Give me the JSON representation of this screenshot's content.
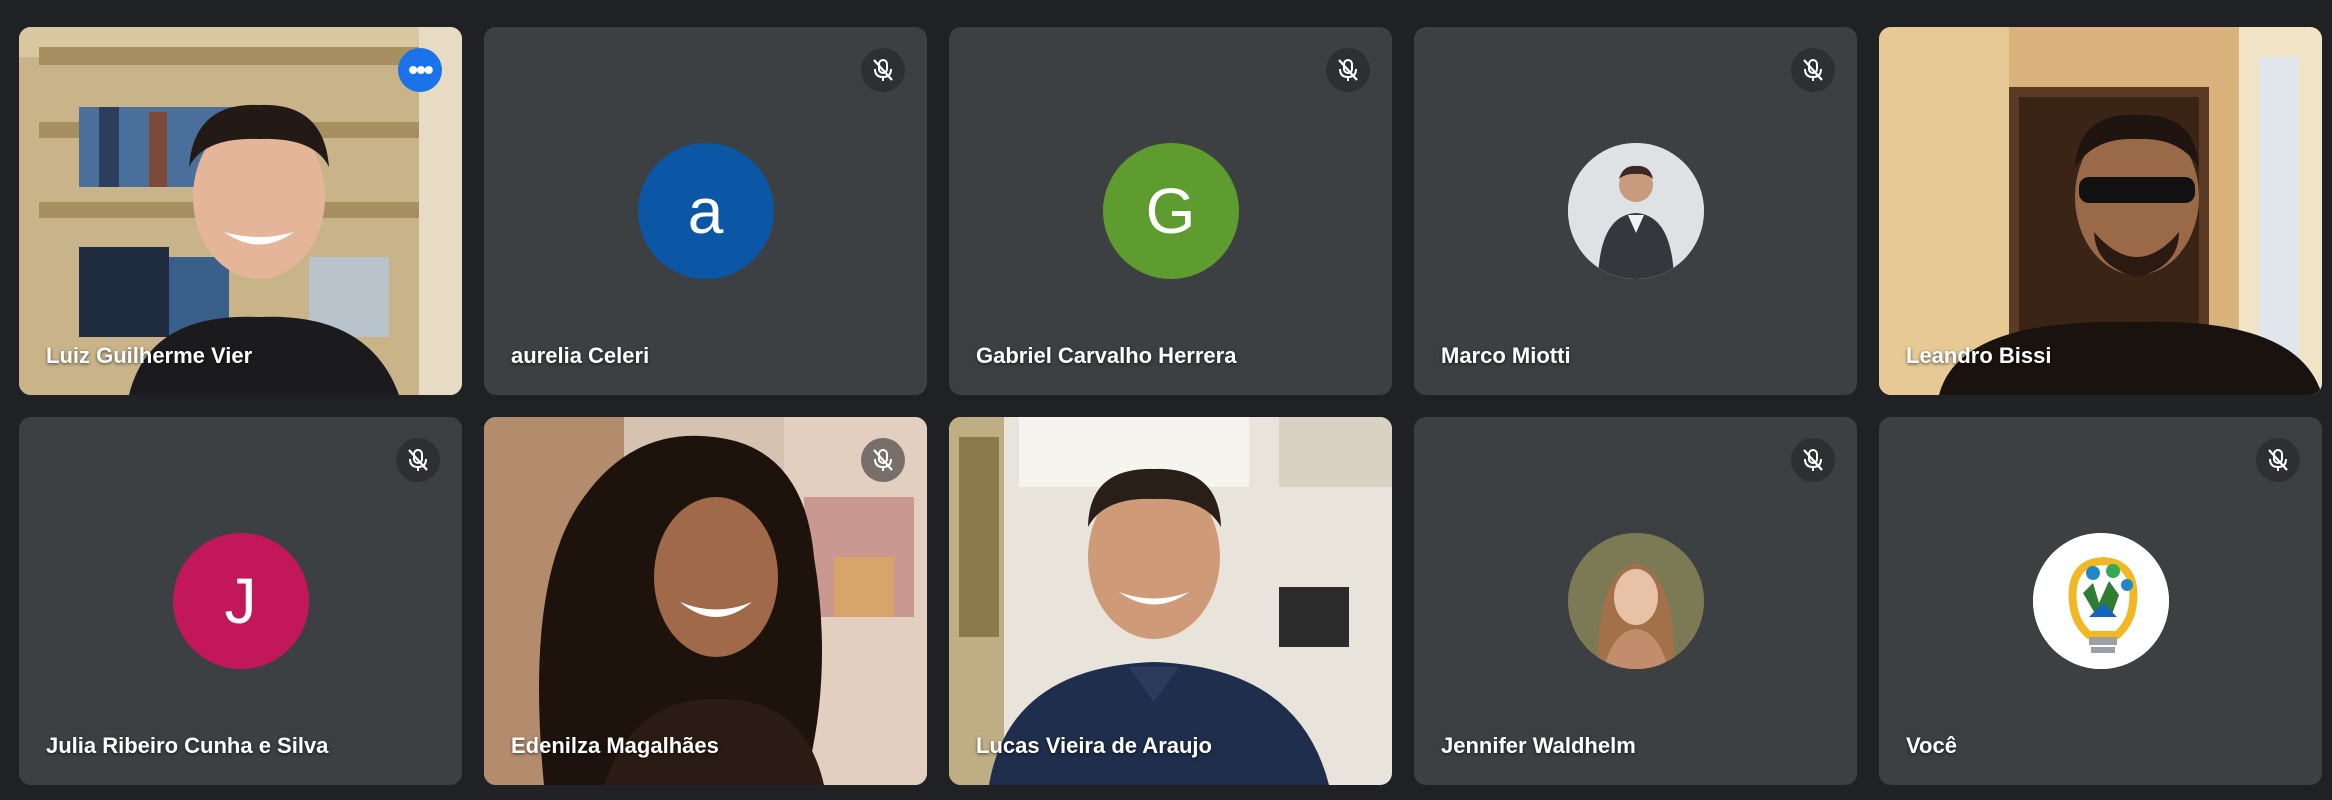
{
  "participants": [
    {
      "name": "Luiz Guilherme Vier",
      "type": "video",
      "muted": false,
      "pinned_menu": true,
      "more_icon": "more-horiz-icon"
    },
    {
      "name": "aurelia Celeri",
      "type": "initial",
      "initial": "a",
      "color": "#0b57a6",
      "muted": true
    },
    {
      "name": "Gabriel Carvalho Herrera",
      "type": "initial",
      "initial": "G",
      "color": "#5f9c2f",
      "muted": true
    },
    {
      "name": "Marco Miotti",
      "type": "photo",
      "muted": true
    },
    {
      "name": "Leandro Bissi",
      "type": "video",
      "muted": false
    },
    {
      "name": "Julia Ribeiro Cunha e Silva",
      "type": "initial",
      "initial": "J",
      "color": "#c2185b",
      "muted": true
    },
    {
      "name": "Edenilza Magalhães",
      "type": "video",
      "muted": true
    },
    {
      "name": "Lucas Vieira de Araujo",
      "type": "video",
      "muted": false
    },
    {
      "name": "Jennifer Waldhelm",
      "type": "photo",
      "muted": true
    },
    {
      "name": "Você",
      "type": "logo",
      "muted": true
    }
  ],
  "icons": {
    "mute": "mic-off-icon",
    "more": "more-horiz-icon"
  },
  "colors": {
    "background": "#202124",
    "tile": "#3c4043",
    "active_border": "#8ab4f8"
  }
}
